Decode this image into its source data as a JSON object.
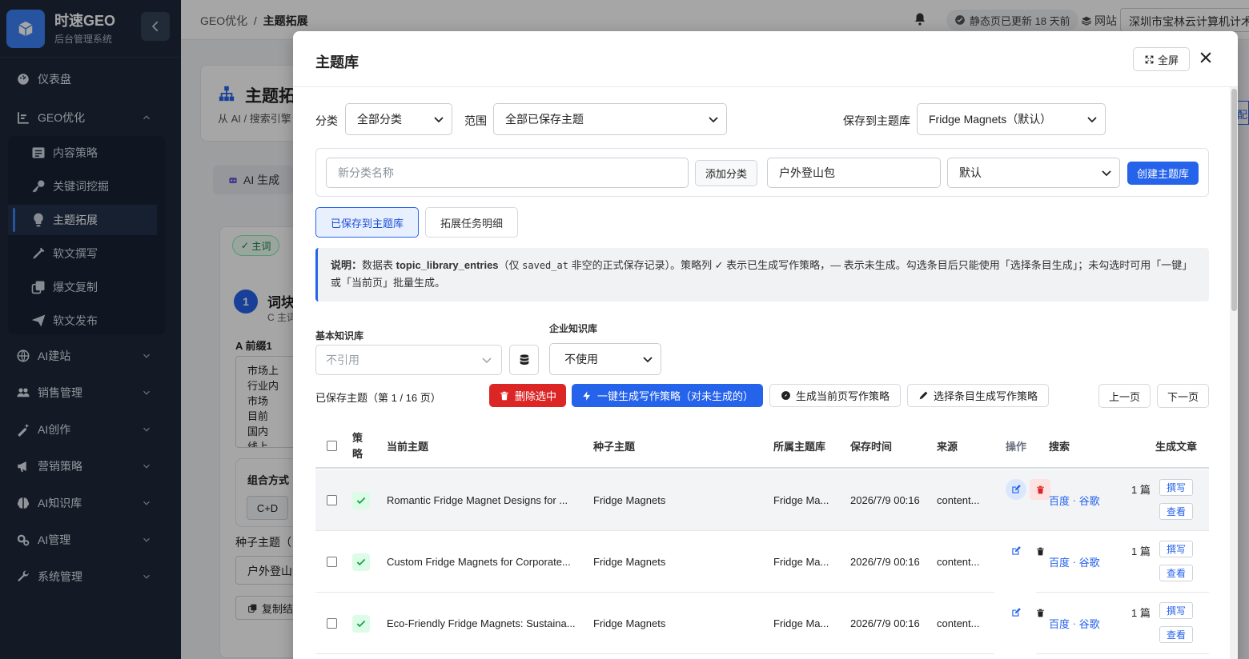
{
  "brand": {
    "name": "时速GEO",
    "subtitle": "后台管理系统"
  },
  "sidebar": {
    "items": [
      {
        "label": "仪表盘",
        "icon": "dashboard-icon"
      },
      {
        "label": "GEO优化",
        "icon": "chart-icon",
        "expanded": true
      },
      {
        "label": "AI建站",
        "icon": "globe-icon"
      },
      {
        "label": "销售管理",
        "icon": "people-icon"
      },
      {
        "label": "AI创作",
        "icon": "magic-icon"
      },
      {
        "label": "营销策略",
        "icon": "megaphone-icon"
      },
      {
        "label": "AI知识库",
        "icon": "brain-icon"
      },
      {
        "label": "AI管理",
        "icon": "gears-icon"
      },
      {
        "label": "系统管理",
        "icon": "wrench-icon"
      }
    ],
    "sub_items": [
      {
        "label": "内容策略",
        "icon": "list-icon"
      },
      {
        "label": "关键词挖掘",
        "icon": "key-icon"
      },
      {
        "label": "主题拓展",
        "icon": "lightbulb-icon",
        "active": true
      },
      {
        "label": "软文撰写",
        "icon": "pen-icon"
      },
      {
        "label": "爆文复制",
        "icon": "copy-icon"
      },
      {
        "label": "软文发布",
        "icon": "send-icon"
      }
    ]
  },
  "topbar": {
    "breadcrumb_parent": "GEO优化",
    "breadcrumb_sep": "/",
    "breadcrumb_current": "主题拓展",
    "status": "静态页已更新 18 天前",
    "site_label": "网站",
    "company": "深圳市宝林云计算机计术"
  },
  "background": {
    "page_title": "主题拓",
    "page_desc": "从 AI / 搜索引擎",
    "ai_tab": "AI 生成",
    "chip_main": "主词",
    "step_num": "1",
    "step_title": "词块",
    "step_sub": "C 主词",
    "prefix_label": "A 前缀1",
    "prefix_lines": [
      "市场上",
      "行业内",
      "市场",
      "目前",
      "国内",
      "线上"
    ],
    "combo_label": "组合方式",
    "combo_value": "C+D",
    "seed_label": "种子主题（",
    "seed_value": "户外登山包",
    "copy_btn": "复制结",
    "right_edge_text": "配"
  },
  "modal": {
    "title": "主题库",
    "fullscreen_label": "全屏",
    "filters": {
      "category_label": "分类",
      "category_value": "全部分类",
      "scope_label": "范围",
      "scope_value": "全部已保存主题",
      "save_to_label": "保存到主题库",
      "save_to_value": "Fridge Magnets（默认）"
    },
    "create": {
      "new_category_placeholder": "新分类名称",
      "add_category_btn": "添加分类",
      "library_name_value": "户外登山包",
      "library_category_value": "默认",
      "create_btn": "创建主题库"
    },
    "tabs": {
      "saved": "已保存到主题库",
      "tasks": "拓展任务明细"
    },
    "note": {
      "prefix": "说明：",
      "body1": "数据表 ",
      "table_name": "topic_library_entries",
      "body2": "（仅 ",
      "field_name": "saved_at",
      "body3": " 非空的正式保存记录）。策略列 ✓ 表示已生成写作策略，— 表示未生成。勾选条目后只能使用「选择条目生成」；未勾选时可用「一键」或「当前页」批量生成。"
    },
    "kb": {
      "basic_label": "基本知识库",
      "basic_placeholder": "不引用",
      "enterprise_label": "企业知识库",
      "enterprise_value": "不使用"
    },
    "toolbar": {
      "summary": "已保存主题（第 1 / 16 页）",
      "delete_selected": "删除选中",
      "one_click": "一键生成写作策略（对未生成的）",
      "gen_page": "生成当前页写作策略",
      "gen_selected": "选择条目生成写作策略",
      "prev": "上一页",
      "next": "下一页"
    },
    "table": {
      "headers": {
        "strategy": "策略",
        "topic": "当前主题",
        "seed": "种子主题",
        "library": "所属主题库",
        "saved_time": "保存时间",
        "source": "来源",
        "ops": "操作",
        "search": "搜索",
        "articles": "生成文章"
      },
      "rows": [
        {
          "topic": "Romantic Fridge Magnet Designs for ...",
          "seed": "Fridge Magnets",
          "library": "Fridge Ma...",
          "saved_time": "2026/7/9 00:16",
          "source": "content...",
          "search_baidu": "百度",
          "search_dot": "·",
          "search_google": "谷歌",
          "count": "1 篇",
          "write": "撰写",
          "view": "查看",
          "strategy_done": true
        },
        {
          "topic": "Custom Fridge Magnets for Corporate...",
          "seed": "Fridge Magnets",
          "library": "Fridge Ma...",
          "saved_time": "2026/7/9 00:16",
          "source": "content...",
          "search_baidu": "百度",
          "search_dot": "·",
          "search_google": "谷歌",
          "count": "1 篇",
          "write": "撰写",
          "view": "查看",
          "strategy_done": true
        },
        {
          "topic": "Eco-Friendly Fridge Magnets: Sustaina...",
          "seed": "Fridge Magnets",
          "library": "Fridge Ma...",
          "saved_time": "2026/7/9 00:16",
          "source": "content...",
          "search_baidu": "百度",
          "search_dot": "·",
          "search_google": "谷歌",
          "count": "1 篇",
          "write": "撰写",
          "view": "查看",
          "strategy_done": true
        }
      ]
    }
  },
  "colors": {
    "primary": "#2563eb",
    "danger": "#dc2626",
    "sidebar": "#1e293b",
    "success": "#16a34a"
  }
}
